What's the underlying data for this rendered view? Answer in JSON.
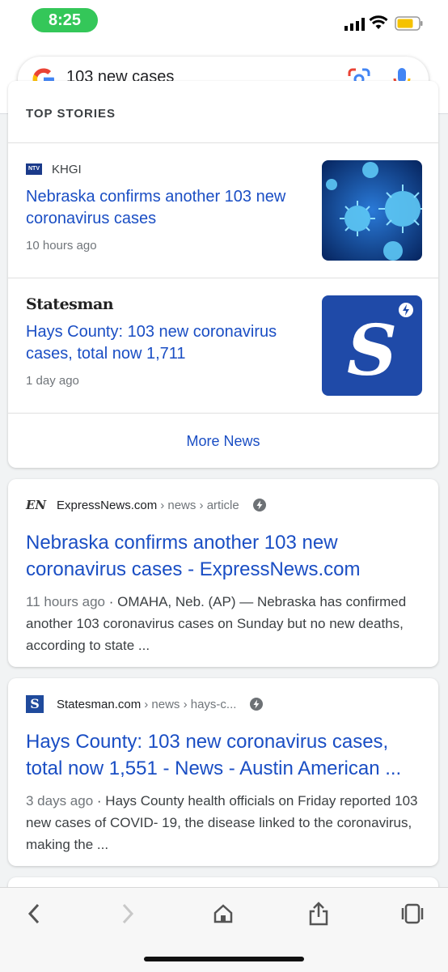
{
  "status_bar": {
    "time": "8:25"
  },
  "search": {
    "query": "103 new cases"
  },
  "top_stories": {
    "title": "TOP STORIES",
    "stories": [
      {
        "source": "KHGI",
        "source_logo": "NTV",
        "title": "Nebraska confirms another 103 new coronavirus cases",
        "time": "10 hours ago",
        "thumb": "coronavirus-image"
      },
      {
        "source": "Statesman",
        "title": "Hays County: 103 new coronavirus cases, total now 1,711",
        "time": "1 day ago",
        "thumb": "statesman-logo-image",
        "thumb_letter": "S"
      }
    ],
    "more_label": "More News"
  },
  "results": [
    {
      "logo": "EN",
      "site": "ExpressNews.com",
      "path": "› news › article",
      "title": "Nebraska confirms another 103 new coronavirus cases - ExpressNews.com",
      "date": "11 hours ago",
      "snippet": " · OMAHA, Neb. (AP) — Nebraska has confirmed another 103 coronavirus cases on Sunday but no new deaths, according to state ..."
    },
    {
      "logo": "S",
      "site": "Statesman.com",
      "path": "› news › hays-c...",
      "title": "Hays County: 103 new coronavirus cases, total now 1,551 - News - Austin American ...",
      "date": "3 days ago",
      "snippet": " · Hays County health officials on Friday reported 103 new cases of COVID- 19, the disease linked to the coronavirus, making the ..."
    }
  ],
  "colors": {
    "link": "#1a4ec4",
    "status_green": "#34c759"
  }
}
